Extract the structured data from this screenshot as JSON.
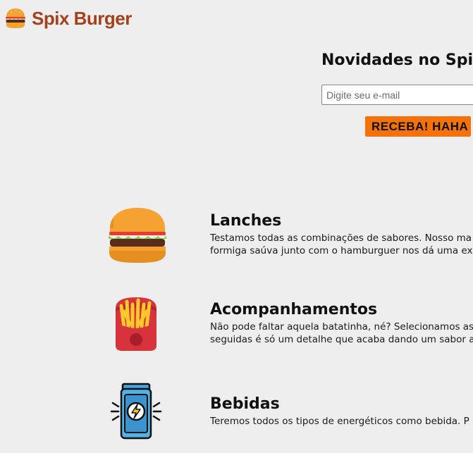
{
  "header": {
    "logo_text": "Spix Burger",
    "logo_icon": "burger-icon"
  },
  "newsletter": {
    "title": "Novidades no Spix B",
    "input_placeholder": "Digite seu e-mail",
    "input_value": "",
    "button_label": "RECEBA! HAHA",
    "button_color": "#f4720c"
  },
  "features": [
    {
      "icon": "burger-icon",
      "title": "Lanches",
      "description_lines": [
        "Testamos todas as combinações de sabores. Nosso ma",
        "formiga saúva junto com o hamburguer nos dá uma exp"
      ]
    },
    {
      "icon": "fries-icon",
      "title": "Acompanhamentos",
      "description_lines": [
        "Não pode faltar aquela batatinha, né? Selecionamos as",
        "seguidas é só um detalhe que acaba dando um sabor ad"
      ]
    },
    {
      "icon": "energy-drink-icon",
      "title": "Bebidas",
      "description_lines": [
        "Teremos todos os tipos de energéticos como bebida. P"
      ]
    }
  ],
  "colors": {
    "background": "#eeeeee",
    "brand": "#a5401a",
    "accent": "#f4720c"
  }
}
